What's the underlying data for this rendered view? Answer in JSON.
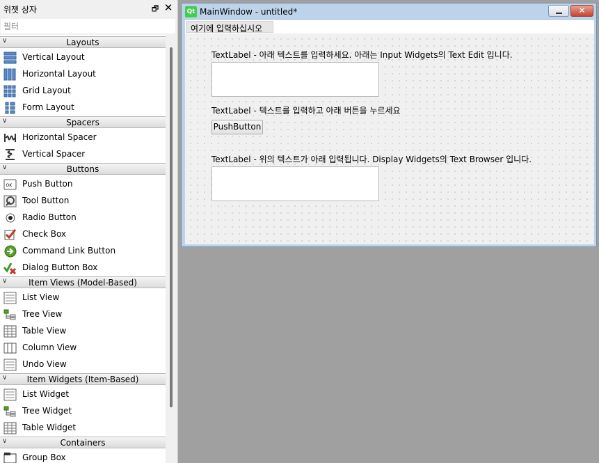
{
  "dock": {
    "title": "위젯 상자",
    "float_glyph": "🗗",
    "close_glyph": "✕",
    "filter_placeholder": "필터"
  },
  "categories": [
    {
      "label": "Layouts",
      "items": [
        {
          "label": "Vertical Layout",
          "icon": "vertical-layout-icon"
        },
        {
          "label": "Horizontal Layout",
          "icon": "horizontal-layout-icon"
        },
        {
          "label": "Grid Layout",
          "icon": "grid-layout-icon"
        },
        {
          "label": "Form Layout",
          "icon": "form-layout-icon"
        }
      ]
    },
    {
      "label": "Spacers",
      "items": [
        {
          "label": "Horizontal Spacer",
          "icon": "horizontal-spacer-icon"
        },
        {
          "label": "Vertical Spacer",
          "icon": "vertical-spacer-icon"
        }
      ]
    },
    {
      "label": "Buttons",
      "items": [
        {
          "label": "Push Button",
          "icon": "push-button-icon"
        },
        {
          "label": "Tool Button",
          "icon": "tool-button-icon"
        },
        {
          "label": "Radio Button",
          "icon": "radio-button-icon"
        },
        {
          "label": "Check Box",
          "icon": "check-box-icon"
        },
        {
          "label": "Command Link Button",
          "icon": "command-link-icon"
        },
        {
          "label": "Dialog Button Box",
          "icon": "dialog-button-box-icon"
        }
      ]
    },
    {
      "label": "Item Views (Model-Based)",
      "items": [
        {
          "label": "List View",
          "icon": "list-view-icon"
        },
        {
          "label": "Tree View",
          "icon": "tree-view-icon"
        },
        {
          "label": "Table View",
          "icon": "table-view-icon"
        },
        {
          "label": "Column View",
          "icon": "column-view-icon"
        },
        {
          "label": "Undo View",
          "icon": "undo-view-icon"
        }
      ]
    },
    {
      "label": "Item Widgets (Item-Based)",
      "items": [
        {
          "label": "List Widget",
          "icon": "list-widget-icon"
        },
        {
          "label": "Tree Widget",
          "icon": "tree-widget-icon"
        },
        {
          "label": "Table Widget",
          "icon": "table-widget-icon"
        }
      ]
    },
    {
      "label": "Containers",
      "items": [
        {
          "label": "Group Box",
          "icon": "group-box-icon"
        }
      ]
    }
  ],
  "mainwindow": {
    "title": "MainWindow - untitled*",
    "qt_logo": "Qt",
    "close_glyph": "✕",
    "menu_item": "여기에 입력하십시오"
  },
  "form": {
    "label1": "TextLabel - 아래 텍스트를 입력하세요. 아래는 Input Widgets의 Text Edit 입니다.",
    "label2": "TextLabel - 텍스트를 입력하고 아래 버튼을 누르세요",
    "push_button": "PushButton",
    "label3": "TextLabel - 위의 텍스트가 아래 입력됩니다. Display Widgets의 Text Browser 입니다."
  }
}
